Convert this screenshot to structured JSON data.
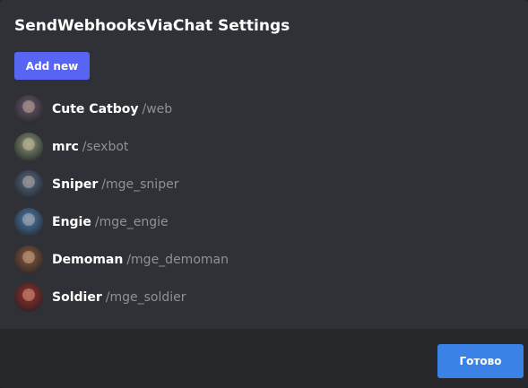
{
  "modal": {
    "title": "SendWebhooksViaChat Settings",
    "add_label": "Add new",
    "done_label": "Готово"
  },
  "colors": {
    "accent": "#5865f2",
    "done": "#3b82e6",
    "background": "#2f3136",
    "footer": "#26282c",
    "muted_text": "#8e9297"
  },
  "webhooks": [
    {
      "name": "Cute Catboy",
      "command": "/web",
      "avatar": "catboy-avatar",
      "avatar_color": "#6b5a6e"
    },
    {
      "name": "mrc",
      "command": "/sexbot",
      "avatar": "mrc-avatar",
      "avatar_color": "#8a9a78"
    },
    {
      "name": "Sniper",
      "command": "/mge_sniper",
      "avatar": "sniper-avatar",
      "avatar_color": "#556b85"
    },
    {
      "name": "Engie",
      "command": "/mge_engie",
      "avatar": "engie-avatar",
      "avatar_color": "#4f7fb3"
    },
    {
      "name": "Demoman",
      "command": "/mge_demoman",
      "avatar": "demoman-avatar",
      "avatar_color": "#8a5a3e"
    },
    {
      "name": "Soldier",
      "command": "/mge_soldier",
      "avatar": "soldier-avatar",
      "avatar_color": "#9c2f2a"
    }
  ]
}
